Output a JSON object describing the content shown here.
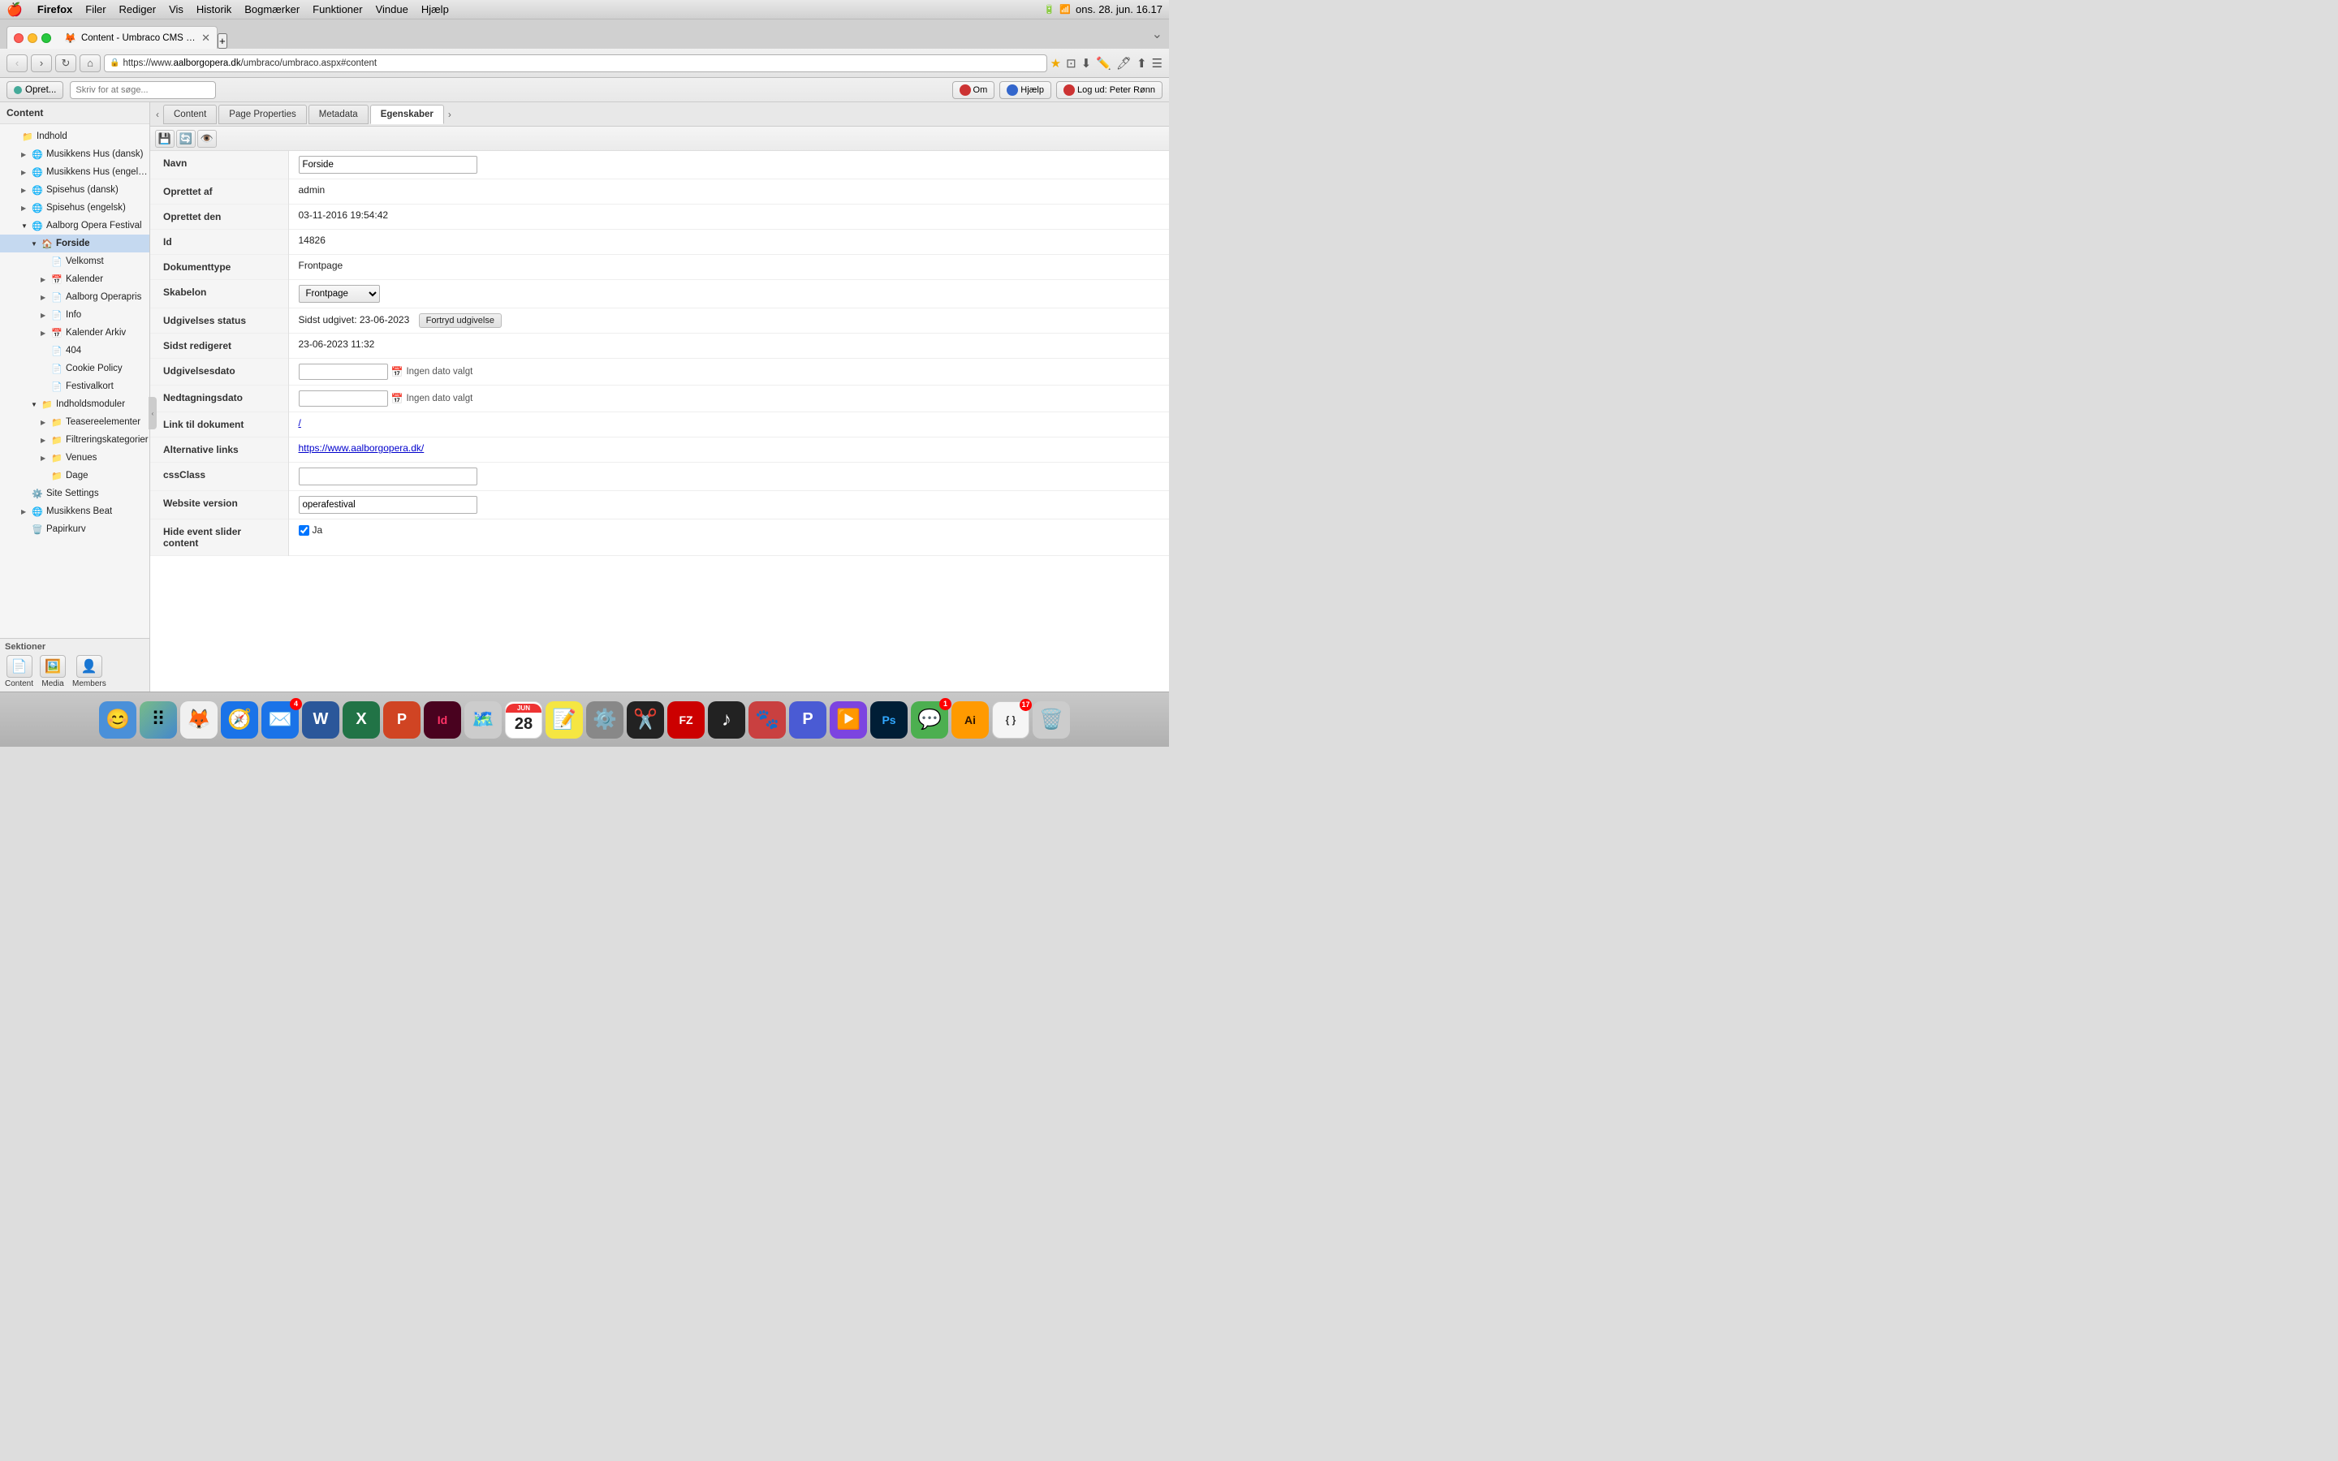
{
  "macMenuBar": {
    "apple": "🍎",
    "items": [
      "Firefox",
      "Filer",
      "Rediger",
      "Vis",
      "Historik",
      "Bogmærker",
      "Funktioner",
      "Vindue",
      "Hjælp"
    ],
    "rightItems": [
      "🔋",
      "wifi",
      "clock"
    ],
    "time": "ons. 28. jun.  16.17"
  },
  "browser": {
    "tab": {
      "title": "Content - Umbraco CMS - .aalborg...",
      "favicon": "🦊"
    },
    "addressBar": {
      "url": "https://www.aalborgopera.dk/umbraco/umbraco.aspx#content",
      "domain": "aalborgopera.dk",
      "prefix": "https://www.",
      "suffix": "/umbraco/umbraco.aspx#content"
    }
  },
  "toolbar": {
    "createBtn": "Opret...",
    "searchPlaceholder": "Skriv for at søge...",
    "omBtn": "Om",
    "hjælpBtn": "Hjælp",
    "logoutBtn": "Log ud: Peter Rønn"
  },
  "sidebar": {
    "header": "Content",
    "tree": [
      {
        "label": "Indhold",
        "level": 1,
        "icon": "📁",
        "hasArrow": false,
        "open": false
      },
      {
        "label": "Musikkens Hus (dansk)",
        "level": 2,
        "icon": "🌐",
        "hasArrow": true,
        "open": false
      },
      {
        "label": "Musikkens Hus (engelsk)",
        "level": 2,
        "icon": "🌐",
        "hasArrow": true,
        "open": false
      },
      {
        "label": "Spisehus (dansk)",
        "level": 2,
        "icon": "🌐",
        "hasArrow": true,
        "open": false
      },
      {
        "label": "Spisehus (engelsk)",
        "level": 2,
        "icon": "🌐",
        "hasArrow": true,
        "open": false
      },
      {
        "label": "Aalborg Opera Festival",
        "level": 2,
        "icon": "🌐",
        "hasArrow": true,
        "open": true
      },
      {
        "label": "Forside",
        "level": 3,
        "icon": "🏠",
        "hasArrow": true,
        "open": true,
        "selected": true
      },
      {
        "label": "Velkomst",
        "level": 4,
        "icon": "📄",
        "hasArrow": false,
        "open": false
      },
      {
        "label": "Kalender",
        "level": 4,
        "icon": "📅",
        "hasArrow": true,
        "open": false
      },
      {
        "label": "Aalborg Operapris",
        "level": 4,
        "icon": "📄",
        "hasArrow": true,
        "open": false
      },
      {
        "label": "Info",
        "level": 4,
        "icon": "📄",
        "hasArrow": true,
        "open": false
      },
      {
        "label": "Kalender Arkiv",
        "level": 4,
        "icon": "📅",
        "hasArrow": true,
        "open": false
      },
      {
        "label": "404",
        "level": 4,
        "icon": "📄",
        "hasArrow": false,
        "open": false
      },
      {
        "label": "Cookie Policy",
        "level": 4,
        "icon": "📄",
        "hasArrow": false,
        "open": false
      },
      {
        "label": "Festivalkort",
        "level": 4,
        "icon": "📄",
        "hasArrow": false,
        "open": false
      },
      {
        "label": "Indholdsmoduler",
        "level": 3,
        "icon": "📁",
        "hasArrow": true,
        "open": true
      },
      {
        "label": "Teasereelementer",
        "level": 4,
        "icon": "📁",
        "hasArrow": true,
        "open": false
      },
      {
        "label": "Filtreringskategorier",
        "level": 4,
        "icon": "📁",
        "hasArrow": true,
        "open": false
      },
      {
        "label": "Venues",
        "level": 4,
        "icon": "📁",
        "hasArrow": true,
        "open": false
      },
      {
        "label": "Dage",
        "level": 4,
        "icon": "📁",
        "hasArrow": false,
        "open": false
      },
      {
        "label": "Site Settings",
        "level": 2,
        "icon": "⚙️",
        "hasArrow": false,
        "open": false
      },
      {
        "label": "Musikkens Beat",
        "level": 2,
        "icon": "🌐",
        "hasArrow": true,
        "open": false
      },
      {
        "label": "Papirkurv",
        "level": 2,
        "icon": "🗑️",
        "hasArrow": false,
        "open": false
      }
    ],
    "sections": {
      "header": "Sektioner",
      "items": [
        {
          "label": "Content",
          "icon": "📄"
        },
        {
          "label": "Media",
          "icon": "🖼️"
        },
        {
          "label": "Members",
          "icon": "👤"
        }
      ]
    }
  },
  "contentTabs": [
    {
      "label": "Content",
      "active": false
    },
    {
      "label": "Page Properties",
      "active": false
    },
    {
      "label": "Metadata",
      "active": false
    },
    {
      "label": "Egenskaber",
      "active": true
    }
  ],
  "contentToolbar": {
    "saveIcon": "💾",
    "refreshIcon": "🔄",
    "previewIcon": "👁️"
  },
  "form": {
    "fields": [
      {
        "label": "Navn",
        "type": "input",
        "value": "Forside"
      },
      {
        "label": "Oprettet af",
        "type": "text",
        "value": "admin"
      },
      {
        "label": "Oprettet den",
        "type": "text",
        "value": "03-11-2016 19:54:42"
      },
      {
        "label": "Id",
        "type": "text",
        "value": "14826"
      },
      {
        "label": "Dokumenttype",
        "type": "text",
        "value": "Frontpage"
      },
      {
        "label": "Skabelon",
        "type": "select",
        "value": "Frontpage",
        "options": [
          "Frontpage"
        ]
      },
      {
        "label": "Udgivelses status",
        "type": "status",
        "published": "Sidst udgivet: 23-06-2023",
        "btn": "Fortryd udgivelse"
      },
      {
        "label": "Sidst redigeret",
        "type": "text",
        "value": "23-06-2023 11:32"
      },
      {
        "label": "Udgivelsesdato",
        "type": "date",
        "value": "",
        "noDate": "Ingen dato valgt"
      },
      {
        "label": "Nedtagningsdato",
        "type": "date",
        "value": "",
        "noDate": "Ingen dato valgt"
      },
      {
        "label": "Link til dokument",
        "type": "link",
        "value": "/"
      },
      {
        "label": "Alternative links",
        "type": "link",
        "value": "https://www.aalborgopera.dk/"
      },
      {
        "label": "cssClass",
        "type": "input",
        "value": ""
      },
      {
        "label": "Website version",
        "type": "input",
        "value": "operafestival"
      },
      {
        "label": "Hide event slider content",
        "type": "checkbox",
        "checked": true,
        "checkLabel": "Ja"
      }
    ]
  },
  "dock": {
    "items": [
      {
        "label": "Finder",
        "icon": "😊",
        "bg": "#4a90d9",
        "badge": ""
      },
      {
        "label": "Launchpad",
        "icon": "⠿",
        "bg": "#888",
        "badge": ""
      },
      {
        "label": "Firefox",
        "icon": "🦊",
        "bg": "#f0f0f0",
        "badge": ""
      },
      {
        "label": "Safari",
        "icon": "🧭",
        "bg": "#1a73e8",
        "badge": ""
      },
      {
        "label": "Mail",
        "icon": "✉️",
        "bg": "#1a73e8",
        "badge": "4"
      },
      {
        "label": "Word",
        "icon": "W",
        "bg": "#2b579a",
        "badge": ""
      },
      {
        "label": "Excel",
        "icon": "X",
        "bg": "#217346",
        "badge": ""
      },
      {
        "label": "PowerPoint",
        "icon": "P",
        "bg": "#d04423",
        "badge": ""
      },
      {
        "label": "InDesign",
        "icon": "Id",
        "bg": "#49021f",
        "badge": ""
      },
      {
        "label": "Maps",
        "icon": "🗺️",
        "bg": "#4a9",
        "badge": ""
      },
      {
        "label": "Calendar",
        "icon": "28",
        "bg": "white",
        "badge": ""
      },
      {
        "label": "Notes",
        "icon": "📝",
        "bg": "#f5e642",
        "badge": ""
      },
      {
        "label": "System Prefs",
        "icon": "⚙️",
        "bg": "#888",
        "badge": ""
      },
      {
        "label": "FinalCut",
        "icon": "✂️",
        "bg": "#222",
        "badge": ""
      },
      {
        "label": "FileZilla",
        "icon": "FZ",
        "bg": "#c00",
        "badge": ""
      },
      {
        "label": "Script",
        "icon": "♪",
        "bg": "#222",
        "badge": ""
      },
      {
        "label": "Paw",
        "icon": "🐾",
        "bg": "#e44",
        "badge": ""
      },
      {
        "label": "Proxyman",
        "icon": "P",
        "bg": "#44a",
        "badge": ""
      },
      {
        "label": "Pockity",
        "icon": "▶️",
        "bg": "#7c44e0",
        "badge": ""
      },
      {
        "label": "Photoshop",
        "icon": "Ps",
        "bg": "#001e36",
        "badge": ""
      },
      {
        "label": "Messages",
        "icon": "💬",
        "bg": "#4caf50",
        "badge": "1"
      },
      {
        "label": "Illustrator",
        "icon": "Ai",
        "bg": "#ff9a00",
        "badge": ""
      },
      {
        "label": "Script Editor",
        "icon": "{ }",
        "bg": "#f5f5f5",
        "badge": "17"
      },
      {
        "label": "Trash",
        "icon": "🗑️",
        "bg": "#ccc",
        "badge": ""
      }
    ]
  }
}
